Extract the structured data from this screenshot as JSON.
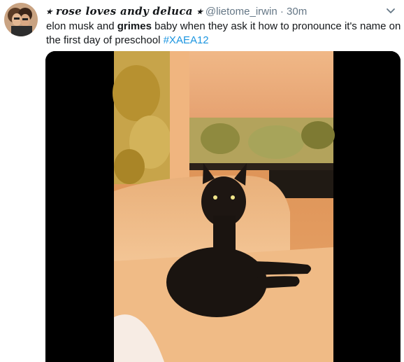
{
  "tweet": {
    "display_name": "⭑ rose loves andy deluca ⭑",
    "handle": "@lietome_irwin",
    "separator": "·",
    "time": "30m",
    "text_before": "elon musk and ",
    "text_bold": "grimes",
    "text_after": " baby when they ask it how to pronounce it's name on the first day of preschool ",
    "hashtag": "#XAEA12"
  },
  "icons": {
    "avatar": "avatar-photo",
    "more": "chevron-down-icon"
  },
  "media": {
    "description_icon": "video-player",
    "background": "#000000"
  },
  "colors": {
    "text": "#14171a",
    "secondary": "#657786",
    "link": "#1b95e0"
  }
}
